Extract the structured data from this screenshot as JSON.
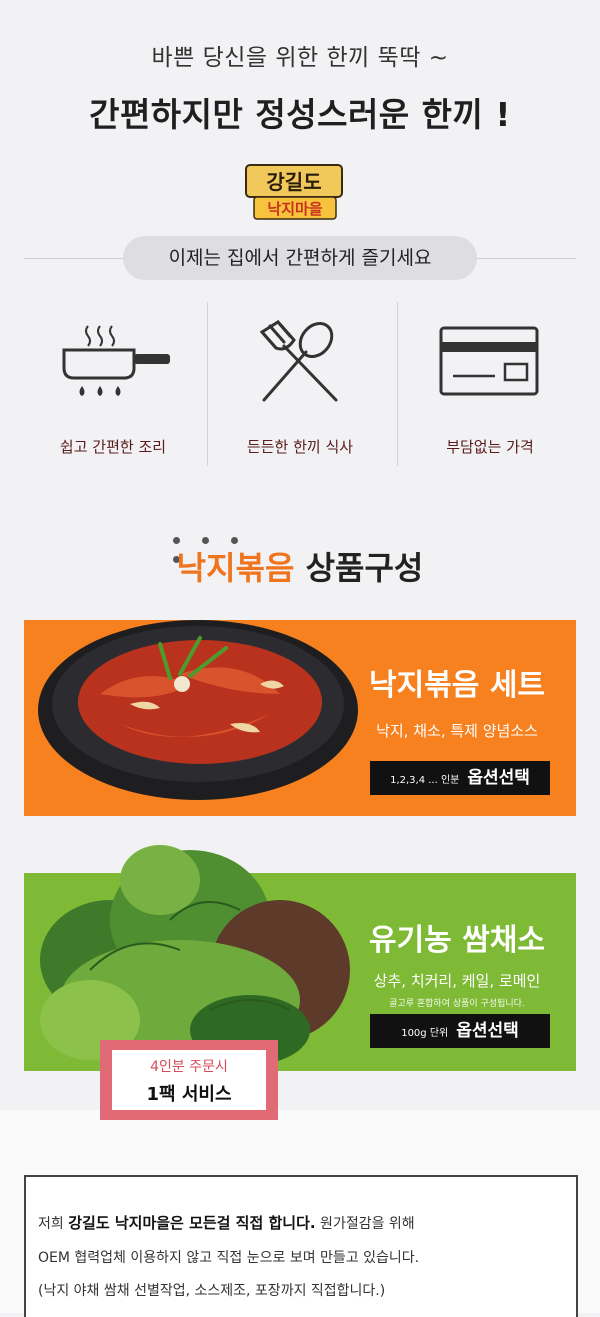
{
  "header": {
    "line1": "바쁜 당신을 위한 한끼 뚝딱 ~",
    "line2": "간편하지만 정성스러운 한끼 !"
  },
  "logo": {
    "top": "강길도",
    "bottom": "낙지마을"
  },
  "pill": {
    "text": "이제는 집에서 간편하게 즐기세요"
  },
  "features": [
    {
      "label": "쉽고 간편한 조리",
      "icon": "pan-icon"
    },
    {
      "label": "든든한 한끼 식사",
      "icon": "fork-spoon-icon"
    },
    {
      "label": "부담없는 가격",
      "icon": "card-icon"
    }
  ],
  "section": {
    "accent": "낙지볶음",
    "rest": " 상품구성"
  },
  "product1": {
    "title": "낙지볶음 세트",
    "subtitle": "낙지, 채소, 특제 양념소스",
    "option_small": "1,2,3,4 ... 인분",
    "option_big": "옵션선택"
  },
  "product2": {
    "title": "유기농 쌈채소",
    "subtitle": "상추, 치커리, 케일, 로메인",
    "note": "골고루 혼합하여 상품이 구성됩니다.",
    "option_small": "100g 단위",
    "option_big": "옵션선택"
  },
  "ticket": {
    "line1": "4인분 주문시",
    "line2": "1팩 서비스"
  },
  "notice": {
    "l1_pre": "저희 ",
    "l1_bold": "강길도 낙지마을은 모든걸 직접 합니다.",
    "l1_post": " 원가절감을 위해",
    "l2": "OEM 협력업체 이용하지 않고 직접 눈으로 보며 만들고 있습니다.",
    "l3": "(낙지 야채 쌈채 선별작업, 소스제조, 포장까지 직접합니다.)"
  },
  "colors": {
    "orange": "#f7801f",
    "green": "#7fba36",
    "maroon": "#5a1c1c",
    "pink": "#e06a76"
  }
}
